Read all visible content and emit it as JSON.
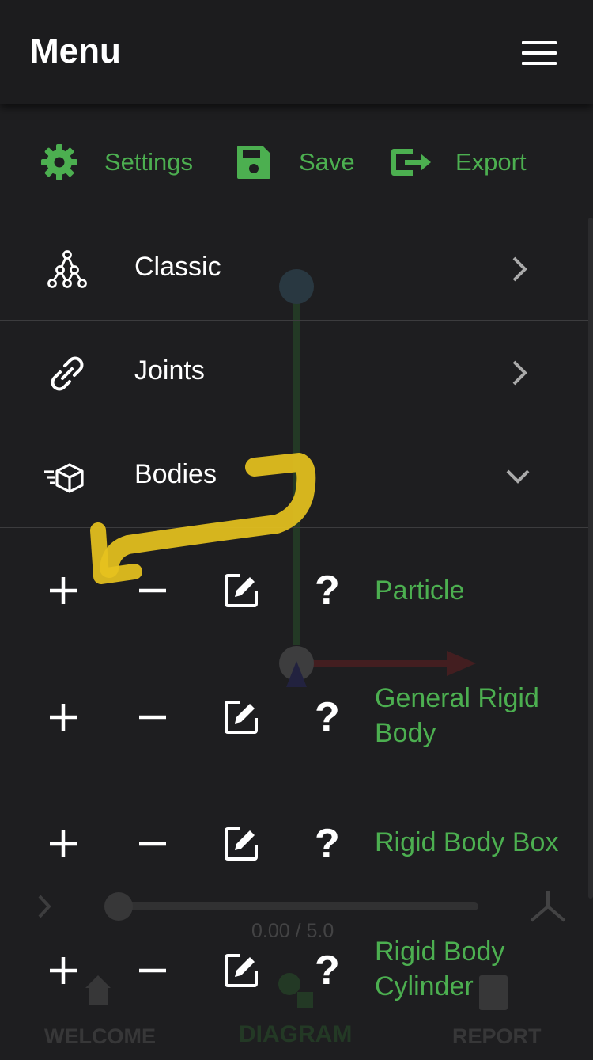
{
  "header": {
    "title": "Menu"
  },
  "actions": [
    {
      "label": "Settings",
      "icon": "gear-icon"
    },
    {
      "label": "Save",
      "icon": "floppy-disk-icon"
    },
    {
      "label": "Export",
      "icon": "export-icon"
    }
  ],
  "menu": [
    {
      "label": "Classic",
      "icon": "hierarchy-icon",
      "state": "collapsed"
    },
    {
      "label": "Joints",
      "icon": "link-icon",
      "state": "collapsed"
    },
    {
      "label": "Bodies",
      "icon": "cube-icon",
      "state": "expanded"
    }
  ],
  "bodies": [
    {
      "label": "Particle"
    },
    {
      "label": "General Rigid Body"
    },
    {
      "label": "Rigid Body Box"
    },
    {
      "label": "Rigid Body Cylinder"
    }
  ],
  "background": {
    "time": "0.00 / 5.0",
    "tabs": [
      "WELCOME",
      "DIAGRAM",
      "REPORT"
    ]
  },
  "colors": {
    "accent": "#4caf50",
    "bg": "#1e1e20",
    "annotation": "#e6c21e"
  }
}
